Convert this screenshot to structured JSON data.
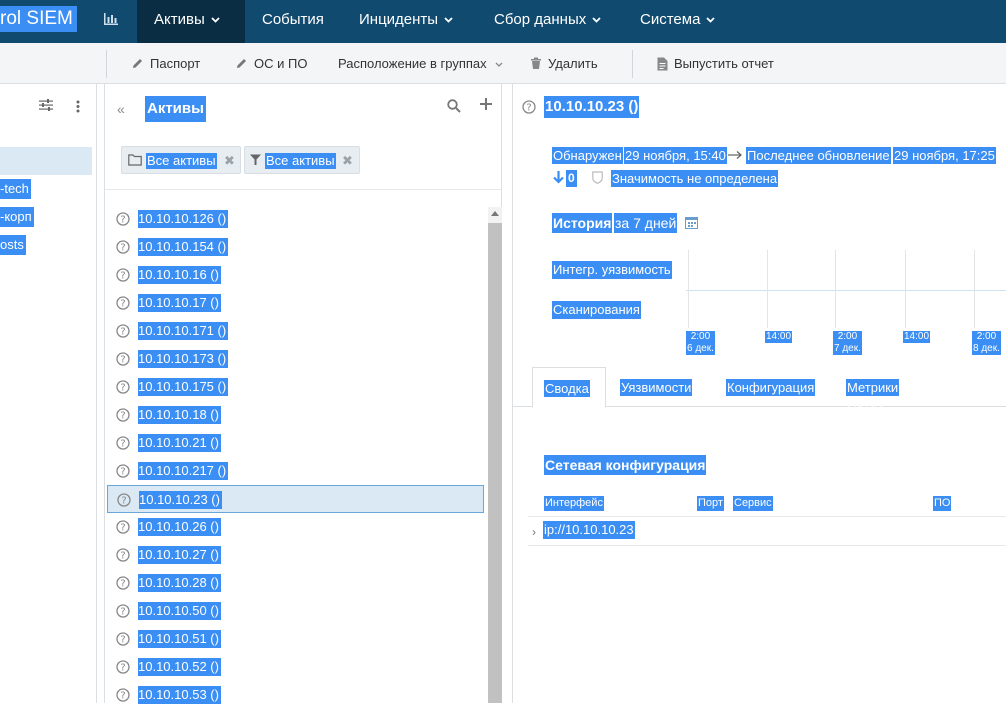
{
  "app": {
    "brand": "rol SIEM"
  },
  "nav": {
    "items": [
      {
        "label": "Активы",
        "active": true
      },
      {
        "label": "События"
      },
      {
        "label": "Инциденты"
      },
      {
        "label": "Сбор данных"
      },
      {
        "label": "Система"
      }
    ]
  },
  "toolbar": {
    "passport": "Паспорт",
    "os": "ОС и ПО",
    "groups": "Расположение в группах",
    "delete": "Удалить",
    "report": "Выпустить отчет"
  },
  "left": {
    "items": [
      "-tech",
      "-корп",
      "osts"
    ]
  },
  "mid": {
    "title": "Активы",
    "chips": {
      "folder": "Все активы",
      "filter": "Все активы"
    },
    "assets": [
      "10.10.10.126 ()",
      "10.10.10.154 ()",
      "10.10.10.16 ()",
      "10.10.10.17 ()",
      "10.10.10.171 ()",
      "10.10.10.173 ()",
      "10.10.10.175 ()",
      "10.10.10.18 ()",
      "10.10.10.21 ()",
      "10.10.10.217 ()",
      "10.10.10.23 ()",
      "10.10.10.26 ()",
      "10.10.10.27 ()",
      "10.10.10.28 ()",
      "10.10.10.50 ()",
      "10.10.10.51 ()",
      "10.10.10.52 ()",
      "10.10.10.53 ()"
    ],
    "selected_index": 10
  },
  "detail": {
    "title": "10.10.10.23 ()",
    "found_label": "Обнаружен",
    "found_value": "29 ноября, 15:40",
    "updated_label": "Последнее обновление",
    "updated_value": "29 ноября, 17:25",
    "down_count": "0",
    "significance": "Значимость не определена",
    "history_title": "История",
    "history_period": "за 7 дней",
    "rows": {
      "vuln": "Интегр. уязвимость",
      "scan": "Сканирования"
    },
    "ticks": [
      {
        "time": "2:00",
        "date": "6 дек."
      },
      {
        "time": "14:00",
        "date": ""
      },
      {
        "time": "2:00",
        "date": "7 дек."
      },
      {
        "time": "14:00",
        "date": ""
      },
      {
        "time": "2:00",
        "date": "8 дек."
      }
    ],
    "tabs": [
      "Сводка",
      "Уязвимости",
      "Конфигурация",
      "Метрики CVSS"
    ],
    "netconf_title": "Сетевая конфигурация",
    "columns": {
      "iface": "Интерфейс",
      "port": "Порт",
      "service": "Сервис",
      "software": "ПО"
    },
    "iface_value": "ip://10.10.10.23"
  },
  "colors": {
    "nav_bg": "#114a6f",
    "nav_active": "#0b2d44",
    "highlight": "#3b8ef3",
    "selected_row": "#dbe9f5"
  }
}
